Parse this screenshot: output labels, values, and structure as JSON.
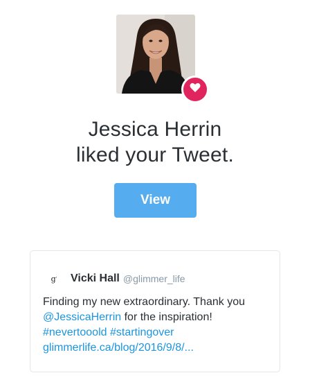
{
  "notification": {
    "actor_name": "Jessica Herrin",
    "action_text": "liked your Tweet.",
    "view_label": "View"
  },
  "icons": {
    "badge": "heart-icon",
    "avatar": "profile-photo",
    "tweet_avatar": "glimmer-logo"
  },
  "colors": {
    "accent": "#55acee",
    "like": "#e0245e",
    "link": "#1b95e0",
    "muted": "#8899a6",
    "text": "#292f33",
    "card_border": "#e1e8ed"
  },
  "tweet": {
    "avatar_text": "g",
    "avatar_sup": "'",
    "author_name": "Vicki Hall",
    "author_handle": "@glimmer_life",
    "text_part1": "Finding my new extraordinary. Thank you",
    "mention": "@JessicaHerrin",
    "text_part2": " for the inspiration!",
    "hashtag1": "#nevertooold",
    "hashtag_sep": " ",
    "hashtag2": "#startingover",
    "url": "glimmerlife.ca/blog/2016/9/8/..."
  }
}
